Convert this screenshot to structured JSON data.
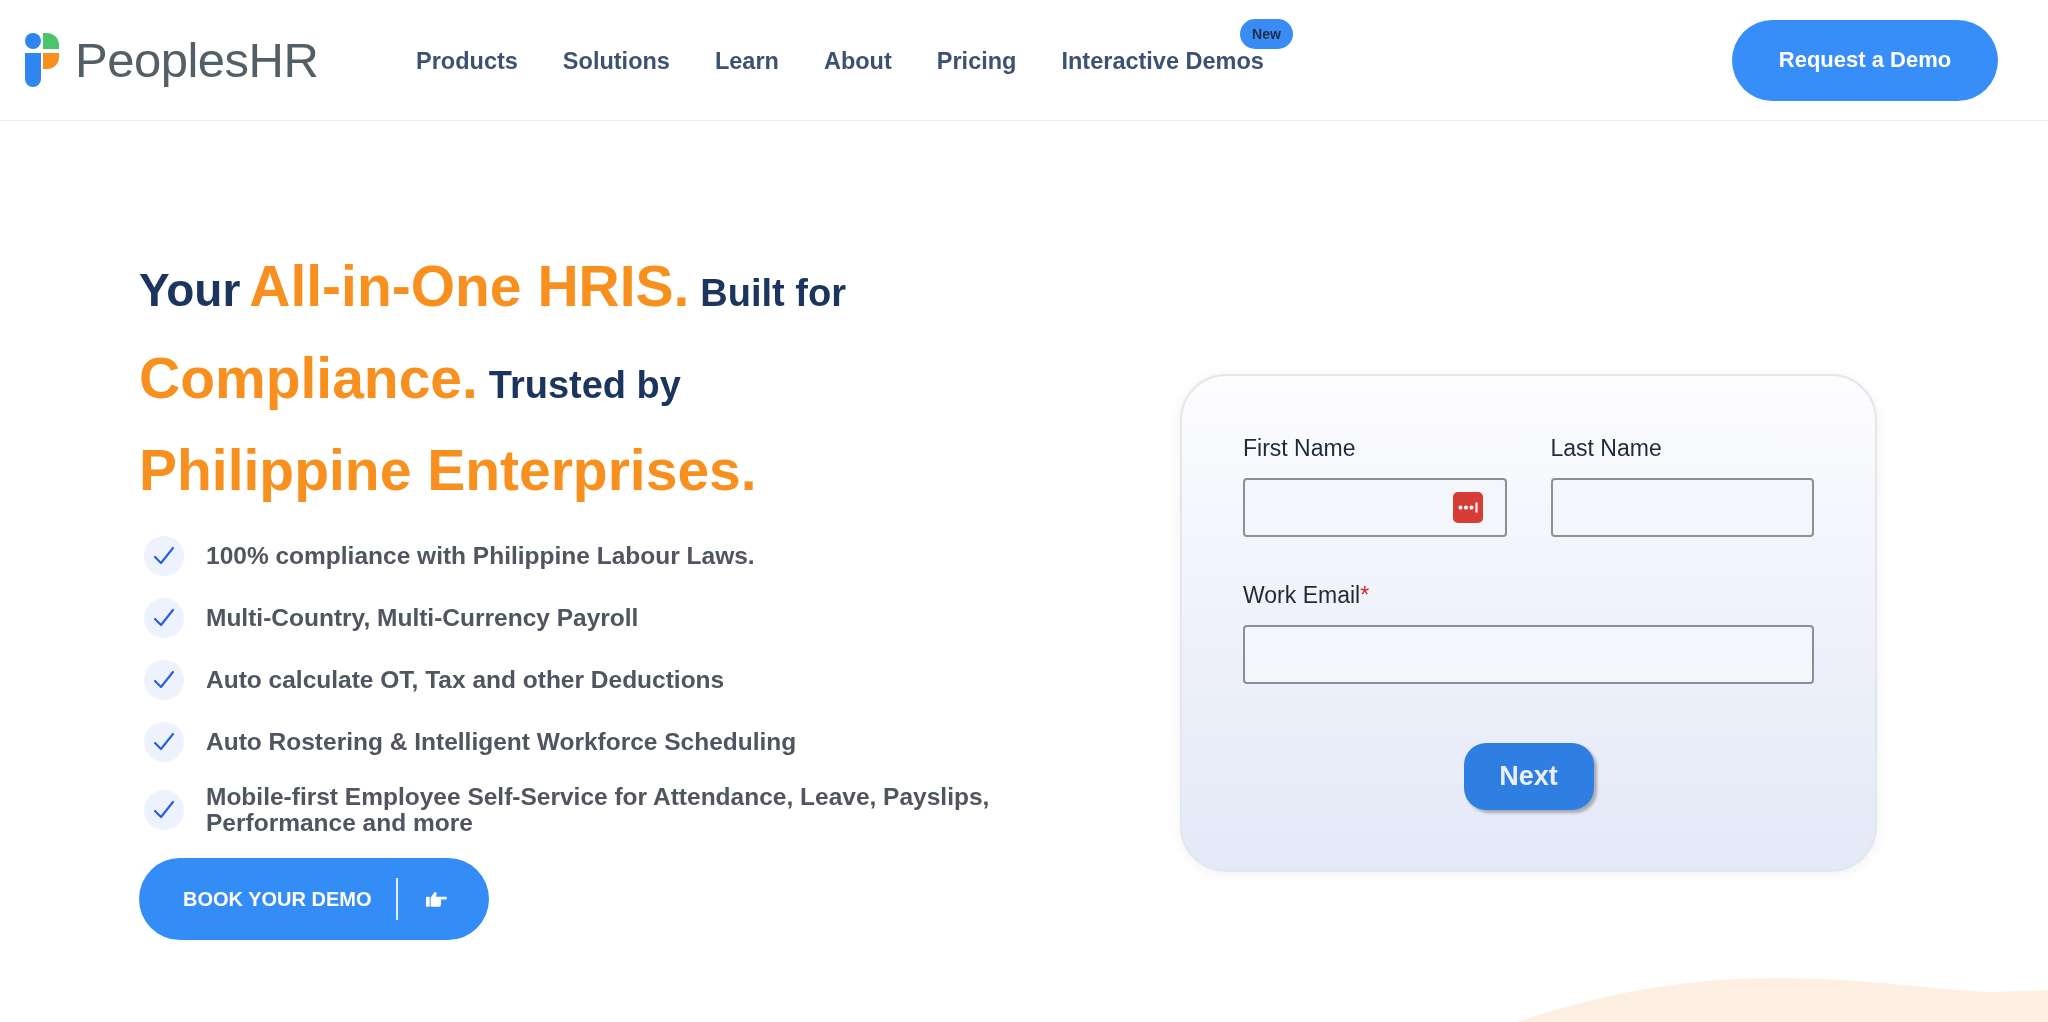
{
  "header": {
    "logo": {
      "text": "PeoplesHR"
    },
    "nav": [
      {
        "label": "Products"
      },
      {
        "label": "Solutions"
      },
      {
        "label": "Learn"
      },
      {
        "label": "About"
      },
      {
        "label": "Pricing"
      },
      {
        "label": "Interactive Demos",
        "badge": "New"
      }
    ],
    "cta": {
      "label": "Request a Demo"
    }
  },
  "hero": {
    "headline": {
      "lines": [
        {
          "segments": [
            {
              "text": "Your",
              "kind": "lead"
            },
            {
              "text": "All-in-One HRIS.",
              "kind": "accent"
            },
            {
              "text": "Built for",
              "kind": "plain"
            }
          ]
        },
        {
          "segments": [
            {
              "text": "Compliance.",
              "kind": "accent"
            },
            {
              "text": "Trusted by",
              "kind": "plain"
            }
          ]
        },
        {
          "segments": [
            {
              "text": "Philippine Enterprises.",
              "kind": "accent"
            }
          ]
        }
      ]
    },
    "features": [
      "100% compliance with Philippine Labour Laws.",
      "Multi-Country, Multi-Currency Payroll",
      "Auto calculate OT, Tax and other Deductions",
      "Auto Rostering & Intelligent Workforce Scheduling",
      "Mobile-first Employee Self-Service for Attendance, Leave, Payslips, Performance and more"
    ],
    "cta": {
      "label": "BOOK YOUR DEMO"
    }
  },
  "form": {
    "rows": [
      {
        "fields": [
          {
            "label": "First Name",
            "password_manager_icon": true
          },
          {
            "label": "Last Name",
            "password_manager_icon": false
          }
        ]
      },
      {
        "fields": [
          {
            "label": "Work Email",
            "required_mark": "*",
            "password_manager_icon": false
          }
        ]
      }
    ],
    "submit": {
      "label": "Next"
    }
  }
}
